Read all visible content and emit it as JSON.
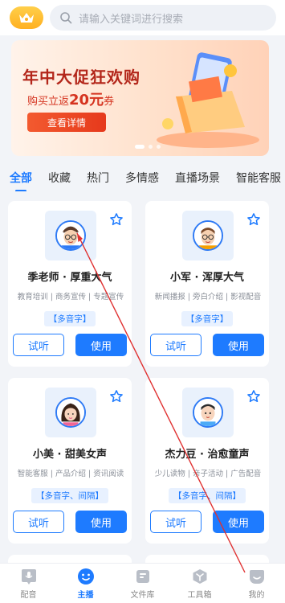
{
  "search": {
    "placeholder": "请输入关键词进行搜索"
  },
  "banner": {
    "title": "年中大促狂欢购",
    "sub_prefix": "购买立返",
    "sub_amount": "20元",
    "sub_suffix": "券",
    "cta": "查看详情"
  },
  "tabs": [
    "全部",
    "收藏",
    "热门",
    "多情感",
    "直播场景",
    "智能客服"
  ],
  "cards": [
    {
      "name": "季老师 · 厚重大气",
      "tags": "教育培训 | 商务宣传 | 专题宣传",
      "feature": "【多音字】",
      "avatar": "male-glasses-avatar"
    },
    {
      "name": "小军 · 浑厚大气",
      "tags": "新闻播报 | 旁白介绍 | 影视配音",
      "feature": "【多音字】",
      "avatar": "male-glasses-avatar"
    },
    {
      "name": "小美 · 甜美女声",
      "tags": "智能客服 | 产品介绍 | 资讯阅读",
      "feature": "【多音字、间隔】",
      "avatar": "female-avatar"
    },
    {
      "name": "杰力豆 · 治愈童声",
      "tags": "少儿读物 | 亲子活动 | 广告配音",
      "feature": "【多音字、间隔】",
      "avatar": "child-avatar"
    }
  ],
  "buttons": {
    "try": "试听",
    "use": "使用"
  },
  "nav": [
    {
      "label": "配音",
      "icon": "microphone-icon",
      "active": false
    },
    {
      "label": "主播",
      "icon": "face-icon",
      "active": true
    },
    {
      "label": "文件库",
      "icon": "file-icon",
      "active": false
    },
    {
      "label": "工具箱",
      "icon": "toolbox-icon",
      "active": false
    },
    {
      "label": "我的",
      "icon": "profile-icon",
      "active": false
    }
  ],
  "colors": {
    "accent": "#1e7bff",
    "banner_red": "#b3261a",
    "vip": "#ffb020"
  }
}
